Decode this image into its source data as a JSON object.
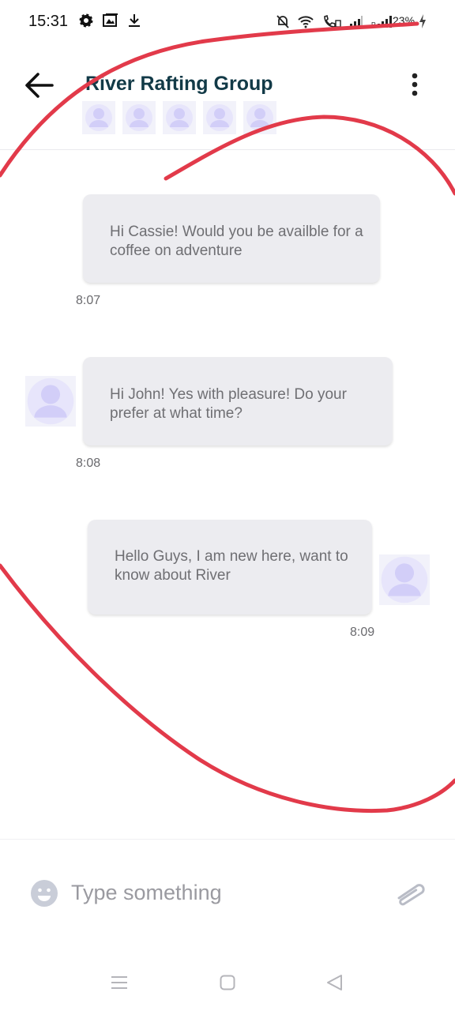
{
  "status_bar": {
    "time": "15:31",
    "battery": "23%"
  },
  "header": {
    "title": "River Rafting Group",
    "member_count_shown": 5
  },
  "messages": [
    {
      "text": "Hi Cassie! Would you be availble for a coffee on adventure",
      "time": "8:07"
    },
    {
      "text": "Hi John! Yes with pleasure! Do your prefer at what time?",
      "time": "8:08"
    },
    {
      "text": "Hello Guys, I am new here, want to know about River",
      "time": "8:09"
    }
  ],
  "composer": {
    "placeholder": "Type something"
  },
  "icons": {
    "back": "arrow-left-icon",
    "more": "more-vertical-icon",
    "emoji": "emoji-icon",
    "attach": "paperclip-icon",
    "avatar": "user-avatar-icon"
  },
  "colors": {
    "title": "#123a47",
    "bubble": "#ececf0",
    "avatar_fill": "#dad6fb",
    "annotation_stroke": "#e23a4a"
  }
}
